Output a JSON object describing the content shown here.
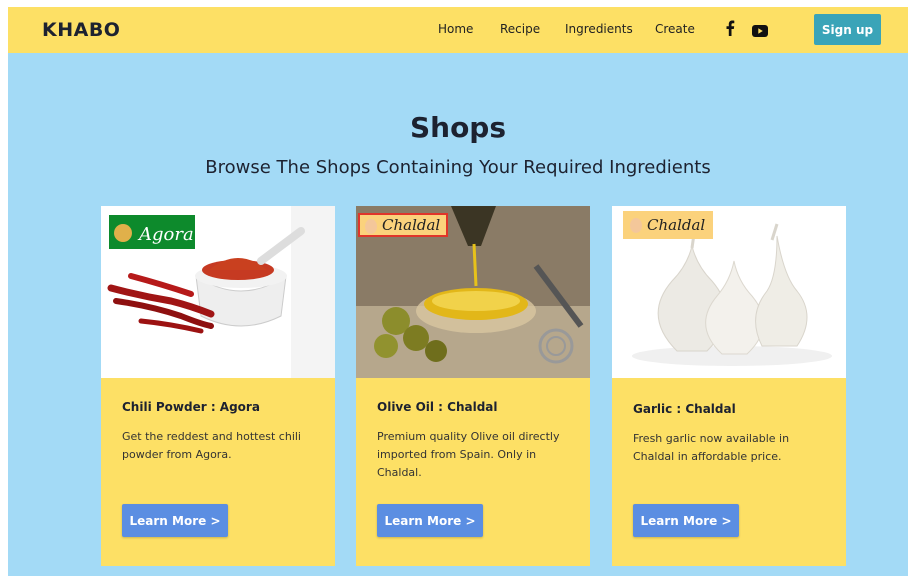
{
  "brand": "KHABO",
  "nav": {
    "links": [
      "Home",
      "Recipe",
      "Ingredients",
      "Create"
    ],
    "signup_label": "Sign up"
  },
  "colors": {
    "nav_bg": "#fde065",
    "page_bg": "#a3daf6",
    "card_bg": "#fde065",
    "button": "#5b8ee2",
    "signup": "#3aa4b8"
  },
  "hero": {
    "title": "Shops",
    "subtitle": "Browse The Shops Containing Your Required Ingredients"
  },
  "cards": [
    {
      "title": "Chili Powder : Agora",
      "body": "Get the reddest and hottest chili powder from Agora.",
      "button": "Learn More >",
      "logo": "Agora"
    },
    {
      "title": "Olive Oil : Chaldal",
      "body": "Premium quality Olive oil directly imported from Spain. Only in Chaldal.",
      "button": "Learn More >",
      "logo": "Chaldal"
    },
    {
      "title": "Garlic : Chaldal",
      "body": "Fresh garlic now available in Chaldal in affordable price.",
      "button": "Learn More >",
      "logo": "Chaldal"
    }
  ]
}
